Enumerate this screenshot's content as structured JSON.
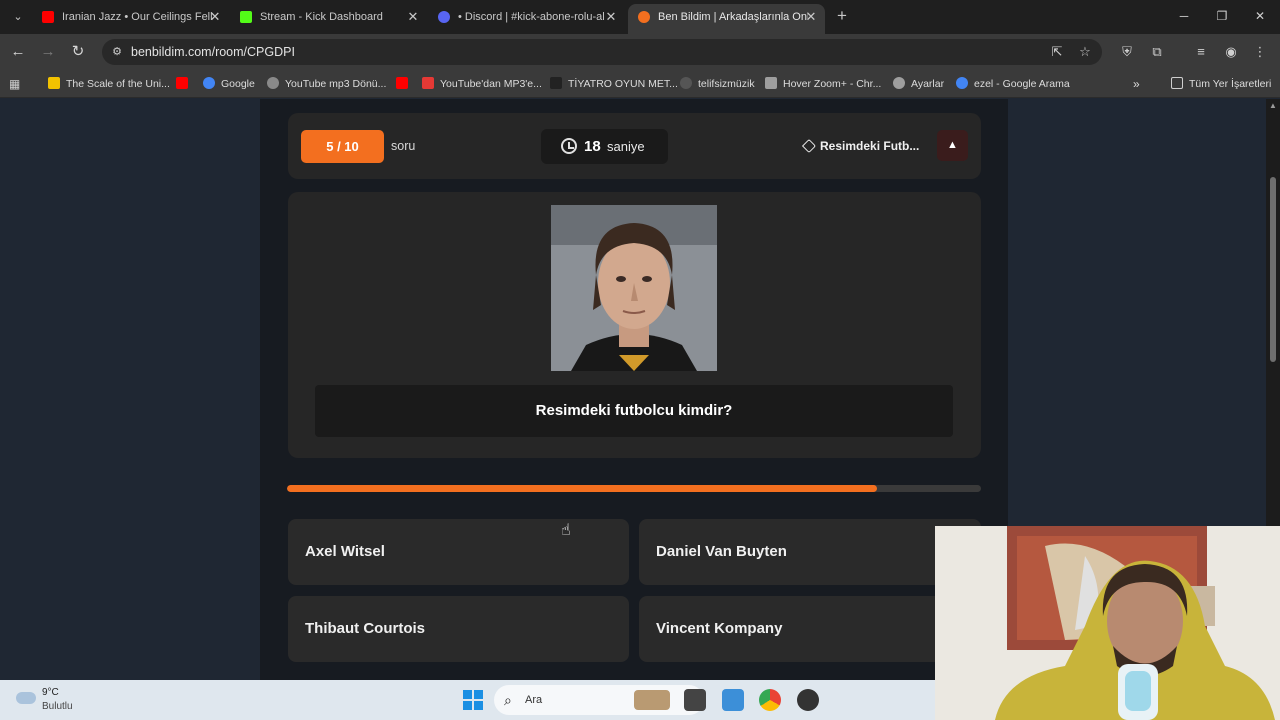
{
  "browser": {
    "tabs": [
      {
        "label": "Iranian Jazz • Our Ceilings Fell A",
        "favicon_color": "#ff0000",
        "active": false
      },
      {
        "label": "Stream - Kick Dashboard",
        "favicon_color": "#53fc18",
        "active": false
      },
      {
        "label": "• Discord | #kick-abone-rolu-al",
        "favicon_color": "#5865f2",
        "active": false
      },
      {
        "label": "Ben Bildim | Arkadaşlarınla Onli",
        "favicon_color": "#f36f1f",
        "active": true
      }
    ],
    "url": "benbildim.com/room/CPGDPI",
    "bookmarks": [
      {
        "label": "The Scale of the Uni...",
        "color": "#f2c200"
      },
      {
        "label": "",
        "color": "#ff0000"
      },
      {
        "label": "Google",
        "color": "#4285f4"
      },
      {
        "label": "YouTube mp3 Dönü...",
        "color": "#8a8a8a"
      },
      {
        "label": "",
        "color": "#ff0000"
      },
      {
        "label": "YouTube'dan MP3'e...",
        "color": "#e53935"
      },
      {
        "label": "TİYATRO OYUN MET...",
        "color": "#222222"
      },
      {
        "label": "telifsizmüzik",
        "color": "#555555"
      },
      {
        "label": "Hover Zoom+ - Chr...",
        "color": "#9e9e9e"
      },
      {
        "label": "Ayarlar",
        "color": "#9e9e9e"
      },
      {
        "label": "ezel - Google Arama",
        "color": "#4285f4"
      }
    ],
    "all_bookmarks_label": "Tüm Yer İşaretleri"
  },
  "quiz": {
    "question_counter": "5 / 10",
    "question_word": "soru",
    "timer_value": "18",
    "timer_unit": "saniye",
    "category": "Resimdeki Futb...",
    "report_icon": "warning-icon",
    "question": "Resimdeki futbolcu kimdir?",
    "progress_fraction": 0.85,
    "answers": [
      "Axel Witsel",
      "Daniel Van Buyten",
      "Thibaut Courtois",
      "Vincent Kompany"
    ],
    "accent_color": "#f36f1f"
  },
  "taskbar": {
    "temperature": "9°C",
    "condition": "Bulutlu",
    "search_placeholder": "Ara"
  }
}
